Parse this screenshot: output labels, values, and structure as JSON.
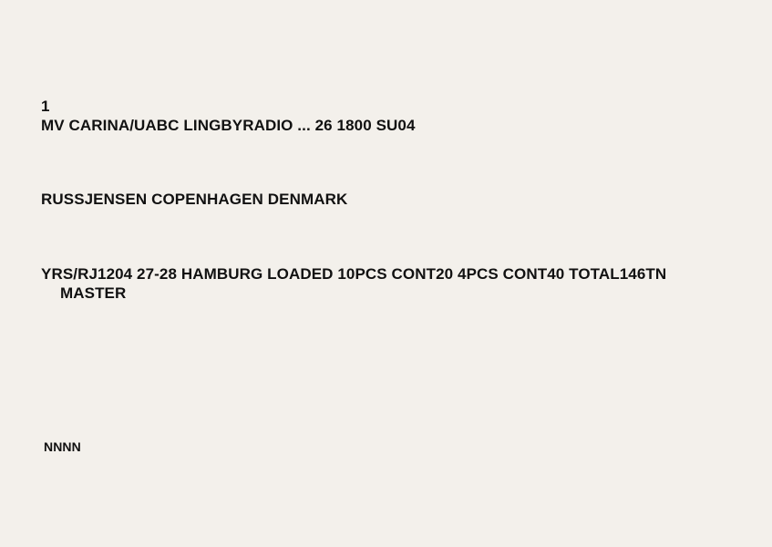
{
  "telegram": {
    "message_number": "1",
    "header": "MV CARINA/UABC LINGBYRADIO ... 26 1800 SU04",
    "address": "RUSSJENSEN COPENHAGEN DENMARK",
    "body": "YRS/RJ1204 27-28 HAMBURG LOADED 10PCS CONT20 4PCS CONT40 TOTAL146TN",
    "signature": "MASTER",
    "end_marker": "NNNN"
  }
}
